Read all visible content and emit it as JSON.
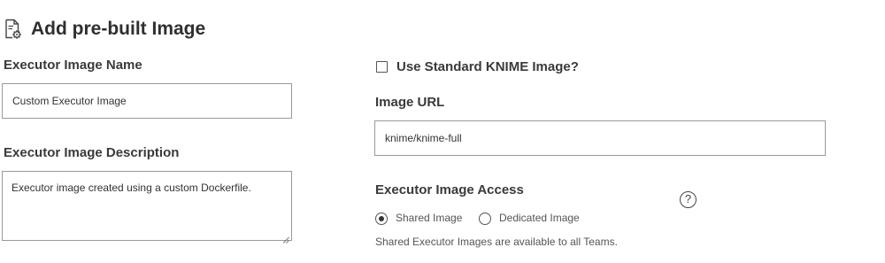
{
  "page": {
    "title": "Add pre-built Image",
    "title_icon": "document-gear-icon"
  },
  "left": {
    "name_label": "Executor Image Name",
    "name_value": "Custom Executor Image",
    "description_label": "Executor Image Description",
    "description_value": "Executor image created using a custom Dockerfile."
  },
  "right": {
    "standard_image_label": "Use Standard KNIME Image?",
    "standard_image_checked": false,
    "url_label": "Image URL",
    "url_value": "knime/knime-full",
    "access_label": "Executor Image Access",
    "access_options": [
      {
        "label": "Shared Image",
        "selected": true
      },
      {
        "label": "Dedicated Image",
        "selected": false
      }
    ],
    "access_help_icon": "help-circle-icon",
    "access_help_glyph": "?",
    "access_note": "Shared Executor Images are available to all Teams."
  }
}
